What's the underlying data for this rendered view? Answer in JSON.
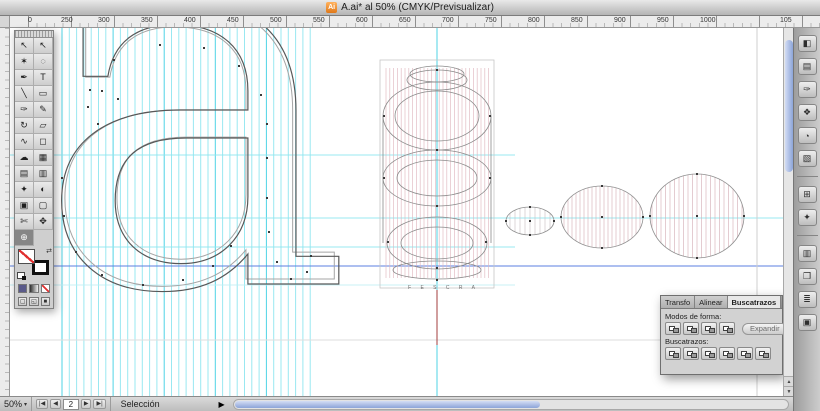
{
  "window": {
    "title": "A.ai* al 50% (CMYK/Previsualizar)",
    "app_icon": "Ai"
  },
  "rulers": {
    "horizontal": [
      "0",
      "250",
      "300",
      "350",
      "400",
      "450",
      "500",
      "550",
      "600",
      "650",
      "700",
      "750",
      "800",
      "850",
      "900",
      "950",
      "1000",
      "105"
    ]
  },
  "toolbar": {
    "tools": [
      {
        "name": "selection-tool",
        "glyph": "↖",
        "active": false
      },
      {
        "name": "direct-selection-tool",
        "glyph": "↖",
        "active": false
      },
      {
        "name": "magic-wand-tool",
        "glyph": "✶",
        "active": false
      },
      {
        "name": "lasso-tool",
        "glyph": "◌",
        "active": false
      },
      {
        "name": "pen-tool",
        "glyph": "✒",
        "active": false
      },
      {
        "name": "type-tool",
        "glyph": "T",
        "active": false
      },
      {
        "name": "line-tool",
        "glyph": "╲",
        "active": false
      },
      {
        "name": "rectangle-tool",
        "glyph": "▭",
        "active": false
      },
      {
        "name": "paintbrush-tool",
        "glyph": "✑",
        "active": false
      },
      {
        "name": "pencil-tool",
        "glyph": "✎",
        "active": false
      },
      {
        "name": "rotate-tool",
        "glyph": "↻",
        "active": false
      },
      {
        "name": "scale-tool",
        "glyph": "▱",
        "active": false
      },
      {
        "name": "warp-tool",
        "glyph": "∿",
        "active": false
      },
      {
        "name": "free-transform-tool",
        "glyph": "◻",
        "active": false
      },
      {
        "name": "symbol-sprayer-tool",
        "glyph": "☁",
        "active": false
      },
      {
        "name": "graph-tool",
        "glyph": "▦",
        "active": false
      },
      {
        "name": "mesh-tool",
        "glyph": "▤",
        "active": false
      },
      {
        "name": "gradient-tool",
        "glyph": "▥",
        "active": false
      },
      {
        "name": "eyedropper-tool",
        "glyph": "✦",
        "active": false
      },
      {
        "name": "blend-tool",
        "glyph": "◐",
        "active": false
      },
      {
        "name": "live-paint-bucket-tool",
        "glyph": "▣",
        "active": false
      },
      {
        "name": "live-paint-selection-tool",
        "glyph": "▢",
        "active": false
      },
      {
        "name": "scissors-tool",
        "glyph": "✄",
        "active": false
      },
      {
        "name": "hand-tool",
        "glyph": "✥",
        "active": false
      },
      {
        "name": "zoom-tool",
        "glyph": "⊕",
        "active": true
      }
    ],
    "swap_icon": "⇄",
    "color_buttons": [
      {
        "name": "color-button"
      },
      {
        "name": "gradient-button"
      },
      {
        "name": "none-button"
      }
    ],
    "screen_modes": [
      {
        "name": "standard-screen-mode-button",
        "glyph": "▢"
      },
      {
        "name": "full-screen-menu-mode-button",
        "glyph": "◱"
      },
      {
        "name": "full-screen-mode-button",
        "glyph": "■"
      }
    ]
  },
  "dock": {
    "icons": [
      {
        "name": "dock-icon-1",
        "glyph": "◧"
      },
      {
        "name": "dock-icon-2",
        "glyph": "▤"
      },
      {
        "name": "dock-icon-3",
        "glyph": "✑"
      },
      {
        "name": "dock-icon-4",
        "glyph": "❖"
      },
      {
        "name": "dock-icon-5",
        "glyph": "◔"
      },
      {
        "name": "dock-icon-6",
        "glyph": "▧"
      },
      {
        "name": "dock-icon-7",
        "glyph": "⊞"
      },
      {
        "name": "dock-icon-8",
        "glyph": "✦"
      },
      {
        "name": "dock-icon-9",
        "glyph": "▥"
      },
      {
        "name": "dock-icon-10",
        "glyph": "❒"
      },
      {
        "name": "dock-icon-11",
        "glyph": "≣"
      },
      {
        "name": "dock-icon-12",
        "glyph": "▣"
      }
    ]
  },
  "pathfinder": {
    "tabs": [
      {
        "label": "Transfo",
        "active": false
      },
      {
        "label": "Alinear",
        "active": false
      },
      {
        "label": "Buscatrazos",
        "active": true
      }
    ],
    "shape_modes_label": "Modos de forma:",
    "shape_mode_buttons": [
      {
        "name": "unite-button"
      },
      {
        "name": "minus-front-button"
      },
      {
        "name": "intersect-button"
      },
      {
        "name": "exclude-button"
      }
    ],
    "expand_label": "Expandir",
    "pathfinders_label": "Buscatrazos:",
    "pathfinder_buttons": [
      {
        "name": "divide-button"
      },
      {
        "name": "trim-button"
      },
      {
        "name": "merge-button"
      },
      {
        "name": "crop-button"
      },
      {
        "name": "outline-button"
      },
      {
        "name": "minus-back-button"
      }
    ]
  },
  "statusbar": {
    "zoom": "50%",
    "page": "2",
    "status": "Selección",
    "icons": {
      "zoom_dropdown": "▾",
      "first": "|◀",
      "prev": "◀",
      "next": "▶",
      "last": "▶|",
      "popup": "▶",
      "scroll_up": "▲",
      "scroll_down": "▼"
    }
  },
  "canvas": {
    "jar_letters": "F  E  S  C  R  A"
  }
}
